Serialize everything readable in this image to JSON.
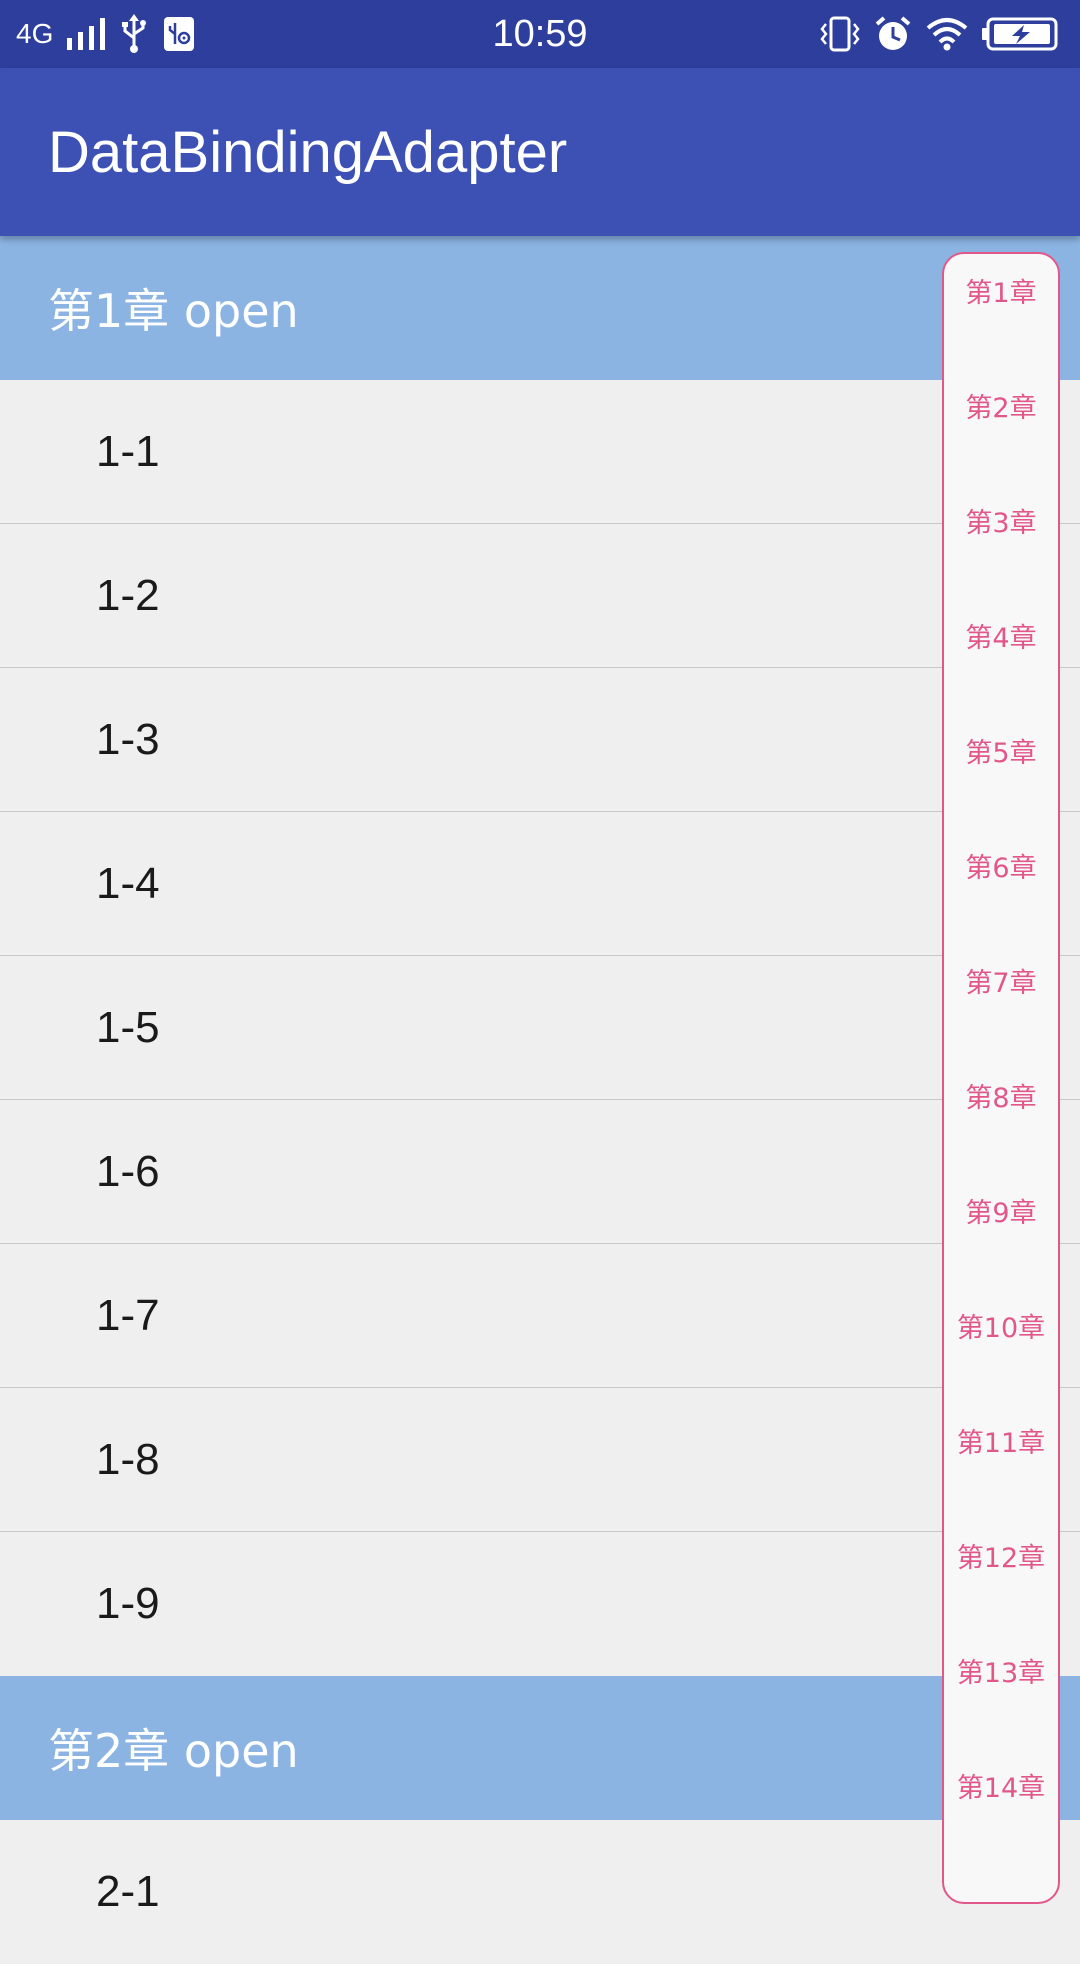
{
  "status_bar": {
    "network": "4G",
    "time": "10:59",
    "icons": [
      "signal-icon",
      "usb-icon",
      "usb-debug-icon",
      "vibrate-icon",
      "alarm-icon",
      "wifi-icon",
      "battery-charging-icon"
    ]
  },
  "app_bar": {
    "title": "DataBindingAdapter"
  },
  "sections": [
    {
      "header": "第1章 open",
      "items": [
        "1-1",
        "1-2",
        "1-3",
        "1-4",
        "1-5",
        "1-6",
        "1-7",
        "1-8",
        "1-9"
      ]
    },
    {
      "header": "第2章 open",
      "items": [
        "2-1"
      ]
    }
  ],
  "index_bar": {
    "items": [
      "第1章",
      "第2章",
      "第3章",
      "第4章",
      "第5章",
      "第6章",
      "第7章",
      "第8章",
      "第9章",
      "第10章",
      "第11章",
      "第12章",
      "第13章",
      "第14章"
    ]
  },
  "colors": {
    "status_bar": "#2e3e9c",
    "app_bar": "#3d51b5",
    "section_header": "#8cb4e3",
    "row_background": "#efefef",
    "index_accent": "#e2578a"
  }
}
